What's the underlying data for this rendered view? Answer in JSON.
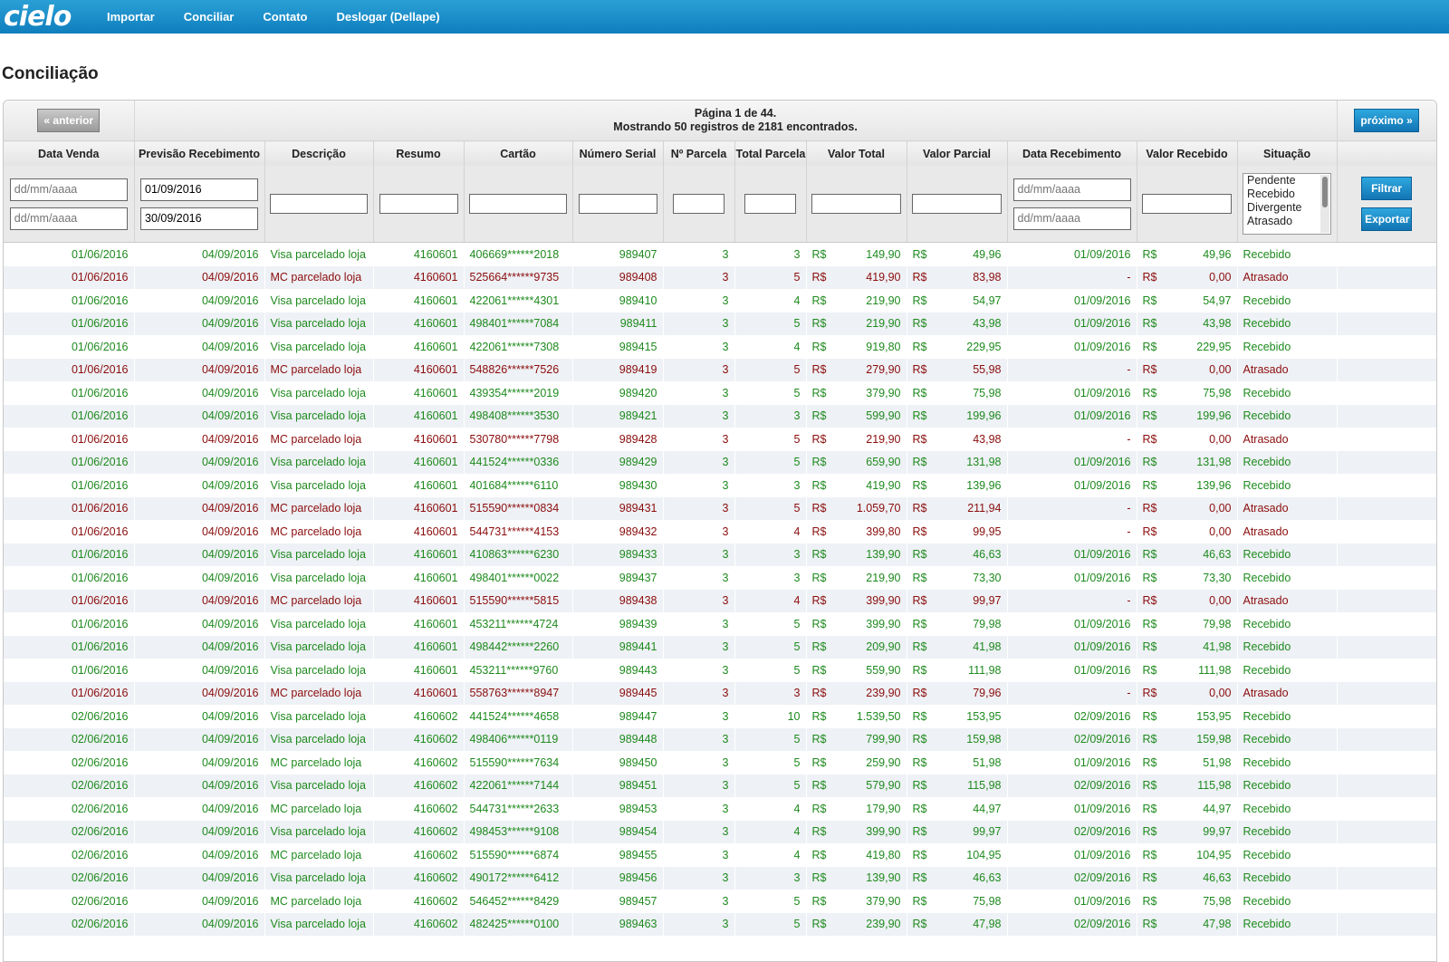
{
  "nav": {
    "logo": "cielo",
    "links": [
      "Importar",
      "Conciliar",
      "Contato",
      "Deslogar (Dellape)"
    ]
  },
  "page_title": "Conciliação",
  "pager": {
    "prev_label": "« anterior",
    "next_label": "próximo »",
    "page_text": "Página 1 de 44.",
    "count_text": "Mostrando 50 registros de 2181 encontrados."
  },
  "columns": [
    "Data Venda",
    "Previsão Recebimento",
    "Descrição",
    "Resumo",
    "Cartão",
    "Número Serial",
    "Nº Parcela",
    "Total Parcela",
    "Valor Total",
    "Valor Parcial",
    "Data Recebimento",
    "Valor Recebido",
    "Situação"
  ],
  "filters": {
    "data_venda_from_placeholder": "dd/mm/aaaa",
    "data_venda_to_placeholder": "dd/mm/aaaa",
    "previsao_from": "01/09/2016",
    "previsao_to": "30/09/2016",
    "data_receb_from_placeholder": "dd/mm/aaaa",
    "data_receb_to_placeholder": "dd/mm/aaaa",
    "situacao_options": [
      "Pendente",
      "Recebido",
      "Divergente",
      "Atrasado"
    ],
    "filter_button": "Filtrar",
    "export_button": "Exportar"
  },
  "currency": "R$",
  "colors": {
    "received": "#1e8a1e",
    "late": "#8b0d0d",
    "accent": "#1a8fcf"
  },
  "rows": [
    [
      "01/06/2016",
      "04/09/2016",
      "Visa parcelado loja",
      "4160601",
      "406669******2018",
      "989407",
      "3",
      "3",
      "149,90",
      "49,96",
      "01/09/2016",
      "49,96",
      "Recebido"
    ],
    [
      "01/06/2016",
      "04/09/2016",
      "MC parcelado loja",
      "4160601",
      "525664******9735",
      "989408",
      "3",
      "5",
      "419,90",
      "83,98",
      "-",
      "0,00",
      "Atrasado"
    ],
    [
      "01/06/2016",
      "04/09/2016",
      "Visa parcelado loja",
      "4160601",
      "422061******4301",
      "989410",
      "3",
      "4",
      "219,90",
      "54,97",
      "01/09/2016",
      "54,97",
      "Recebido"
    ],
    [
      "01/06/2016",
      "04/09/2016",
      "Visa parcelado loja",
      "4160601",
      "498401******7084",
      "989411",
      "3",
      "5",
      "219,90",
      "43,98",
      "01/09/2016",
      "43,98",
      "Recebido"
    ],
    [
      "01/06/2016",
      "04/09/2016",
      "Visa parcelado loja",
      "4160601",
      "422061******7308",
      "989415",
      "3",
      "4",
      "919,80",
      "229,95",
      "01/09/2016",
      "229,95",
      "Recebido"
    ],
    [
      "01/06/2016",
      "04/09/2016",
      "MC parcelado loja",
      "4160601",
      "548826******7526",
      "989419",
      "3",
      "5",
      "279,90",
      "55,98",
      "-",
      "0,00",
      "Atrasado"
    ],
    [
      "01/06/2016",
      "04/09/2016",
      "Visa parcelado loja",
      "4160601",
      "439354******2019",
      "989420",
      "3",
      "5",
      "379,90",
      "75,98",
      "01/09/2016",
      "75,98",
      "Recebido"
    ],
    [
      "01/06/2016",
      "04/09/2016",
      "Visa parcelado loja",
      "4160601",
      "498408******3530",
      "989421",
      "3",
      "3",
      "599,90",
      "199,96",
      "01/09/2016",
      "199,96",
      "Recebido"
    ],
    [
      "01/06/2016",
      "04/09/2016",
      "MC parcelado loja",
      "4160601",
      "530780******7798",
      "989428",
      "3",
      "5",
      "219,90",
      "43,98",
      "-",
      "0,00",
      "Atrasado"
    ],
    [
      "01/06/2016",
      "04/09/2016",
      "Visa parcelado loja",
      "4160601",
      "441524******0336",
      "989429",
      "3",
      "5",
      "659,90",
      "131,98",
      "01/09/2016",
      "131,98",
      "Recebido"
    ],
    [
      "01/06/2016",
      "04/09/2016",
      "Visa parcelado loja",
      "4160601",
      "401684******6110",
      "989430",
      "3",
      "3",
      "419,90",
      "139,96",
      "01/09/2016",
      "139,96",
      "Recebido"
    ],
    [
      "01/06/2016",
      "04/09/2016",
      "MC parcelado loja",
      "4160601",
      "515590******0834",
      "989431",
      "3",
      "5",
      "1.059,70",
      "211,94",
      "-",
      "0,00",
      "Atrasado"
    ],
    [
      "01/06/2016",
      "04/09/2016",
      "MC parcelado loja",
      "4160601",
      "544731******4153",
      "989432",
      "3",
      "4",
      "399,80",
      "99,95",
      "-",
      "0,00",
      "Atrasado"
    ],
    [
      "01/06/2016",
      "04/09/2016",
      "Visa parcelado loja",
      "4160601",
      "410863******6230",
      "989433",
      "3",
      "3",
      "139,90",
      "46,63",
      "01/09/2016",
      "46,63",
      "Recebido"
    ],
    [
      "01/06/2016",
      "04/09/2016",
      "Visa parcelado loja",
      "4160601",
      "498401******0022",
      "989437",
      "3",
      "3",
      "219,90",
      "73,30",
      "01/09/2016",
      "73,30",
      "Recebido"
    ],
    [
      "01/06/2016",
      "04/09/2016",
      "MC parcelado loja",
      "4160601",
      "515590******5815",
      "989438",
      "3",
      "4",
      "399,90",
      "99,97",
      "-",
      "0,00",
      "Atrasado"
    ],
    [
      "01/06/2016",
      "04/09/2016",
      "Visa parcelado loja",
      "4160601",
      "453211******4724",
      "989439",
      "3",
      "5",
      "399,90",
      "79,98",
      "01/09/2016",
      "79,98",
      "Recebido"
    ],
    [
      "01/06/2016",
      "04/09/2016",
      "Visa parcelado loja",
      "4160601",
      "498442******2260",
      "989441",
      "3",
      "5",
      "209,90",
      "41,98",
      "01/09/2016",
      "41,98",
      "Recebido"
    ],
    [
      "01/06/2016",
      "04/09/2016",
      "Visa parcelado loja",
      "4160601",
      "453211******9760",
      "989443",
      "3",
      "5",
      "559,90",
      "111,98",
      "01/09/2016",
      "111,98",
      "Recebido"
    ],
    [
      "01/06/2016",
      "04/09/2016",
      "MC parcelado loja",
      "4160601",
      "558763******8947",
      "989445",
      "3",
      "3",
      "239,90",
      "79,96",
      "-",
      "0,00",
      "Atrasado"
    ],
    [
      "02/06/2016",
      "04/09/2016",
      "Visa parcelado loja",
      "4160602",
      "441524******4658",
      "989447",
      "3",
      "10",
      "1.539,50",
      "153,95",
      "02/09/2016",
      "153,95",
      "Recebido"
    ],
    [
      "02/06/2016",
      "04/09/2016",
      "Visa parcelado loja",
      "4160602",
      "498406******0119",
      "989448",
      "3",
      "5",
      "799,90",
      "159,98",
      "02/09/2016",
      "159,98",
      "Recebido"
    ],
    [
      "02/06/2016",
      "04/09/2016",
      "MC parcelado loja",
      "4160602",
      "515590******7634",
      "989450",
      "3",
      "5",
      "259,90",
      "51,98",
      "01/09/2016",
      "51,98",
      "Recebido"
    ],
    [
      "02/06/2016",
      "04/09/2016",
      "Visa parcelado loja",
      "4160602",
      "422061******7144",
      "989451",
      "3",
      "5",
      "579,90",
      "115,98",
      "02/09/2016",
      "115,98",
      "Recebido"
    ],
    [
      "02/06/2016",
      "04/09/2016",
      "MC parcelado loja",
      "4160602",
      "544731******2633",
      "989453",
      "3",
      "4",
      "179,90",
      "44,97",
      "01/09/2016",
      "44,97",
      "Recebido"
    ],
    [
      "02/06/2016",
      "04/09/2016",
      "Visa parcelado loja",
      "4160602",
      "498453******9108",
      "989454",
      "3",
      "4",
      "399,90",
      "99,97",
      "02/09/2016",
      "99,97",
      "Recebido"
    ],
    [
      "02/06/2016",
      "04/09/2016",
      "MC parcelado loja",
      "4160602",
      "515590******6874",
      "989455",
      "3",
      "4",
      "419,80",
      "104,95",
      "01/09/2016",
      "104,95",
      "Recebido"
    ],
    [
      "02/06/2016",
      "04/09/2016",
      "Visa parcelado loja",
      "4160602",
      "490172******6412",
      "989456",
      "3",
      "3",
      "139,90",
      "46,63",
      "02/09/2016",
      "46,63",
      "Recebido"
    ],
    [
      "02/06/2016",
      "04/09/2016",
      "MC parcelado loja",
      "4160602",
      "546452******8429",
      "989457",
      "3",
      "5",
      "379,90",
      "75,98",
      "01/09/2016",
      "75,98",
      "Recebido"
    ],
    [
      "02/06/2016",
      "04/09/2016",
      "Visa parcelado loja",
      "4160602",
      "482425******0100",
      "989463",
      "3",
      "5",
      "239,90",
      "47,98",
      "02/09/2016",
      "47,98",
      "Recebido"
    ]
  ]
}
